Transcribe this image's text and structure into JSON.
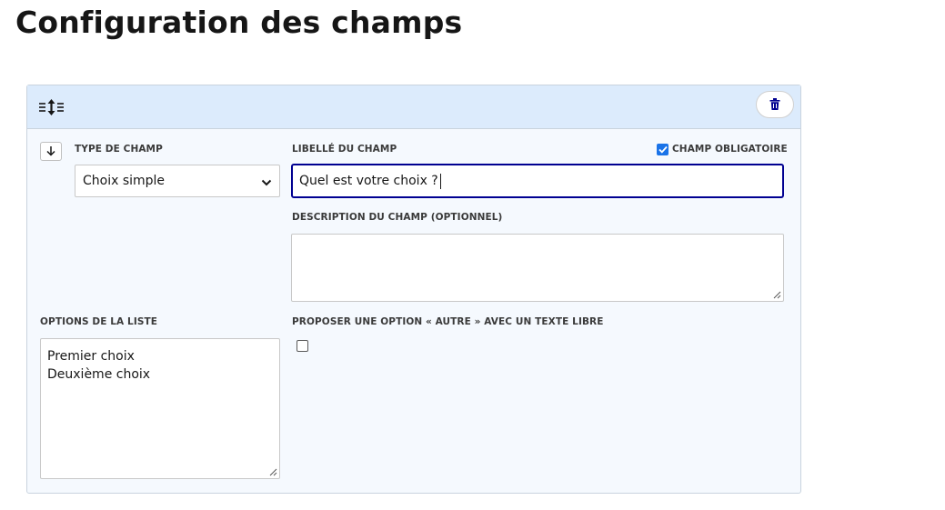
{
  "page": {
    "title": "Configuration des champs"
  },
  "card": {
    "header": {
      "drag_icon": "drag-reorder-icon",
      "delete_icon": "trash-icon"
    },
    "move_down_icon": "arrow-down-icon",
    "field_type": {
      "label": "TYPE DE CHAMP",
      "value": "Choix simple"
    },
    "field_label": {
      "label": "LIBELLÉ DU CHAMP",
      "value": "Quel est votre choix ?"
    },
    "required": {
      "label": "CHAMP OBLIGATOIRE",
      "checked": true
    },
    "description": {
      "label": "DESCRIPTION DU CHAMP (OPTIONNEL)",
      "value": ""
    },
    "options": {
      "label": "OPTIONS DE LA LISTE",
      "value": "Premier choix\nDeuxième choix"
    },
    "other_option": {
      "label": "PROPOSER UNE OPTION « AUTRE » AVEC UN TEXTE LIBRE",
      "checked": false
    }
  },
  "colors": {
    "accent": "#000091",
    "header_bg": "#dcebfc",
    "card_bg": "#f5f9fe",
    "checkbox": "#1a73e8"
  }
}
